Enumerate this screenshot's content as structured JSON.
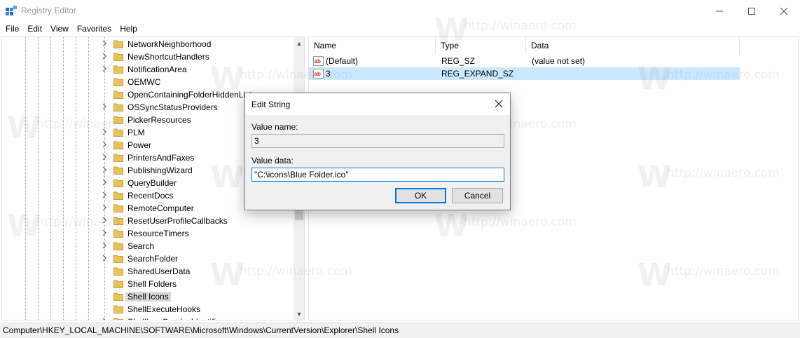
{
  "window": {
    "title": "Registry Editor",
    "minimize_glyph": "—",
    "maximize_glyph": "☐",
    "close_glyph": "✕"
  },
  "menu": [
    "File",
    "Edit",
    "View",
    "Favorites",
    "Help"
  ],
  "tree": {
    "items": [
      {
        "label": "NetworkNeighborhood",
        "expandable": true
      },
      {
        "label": "NewShortcutHandlers",
        "expandable": true
      },
      {
        "label": "NotificationArea",
        "expandable": true
      },
      {
        "label": "OEMWC",
        "expandable": false
      },
      {
        "label": "OpenContainingFolderHiddenList",
        "expandable": false
      },
      {
        "label": "OSSyncStatusProviders",
        "expandable": true
      },
      {
        "label": "PickerResources",
        "expandable": false
      },
      {
        "label": "PLM",
        "expandable": true
      },
      {
        "label": "Power",
        "expandable": true
      },
      {
        "label": "PrintersAndFaxes",
        "expandable": true
      },
      {
        "label": "PublishingWizard",
        "expandable": true
      },
      {
        "label": "QueryBuilder",
        "expandable": true
      },
      {
        "label": "RecentDocs",
        "expandable": true
      },
      {
        "label": "RemoteComputer",
        "expandable": true
      },
      {
        "label": "ResetUserProfileCallbacks",
        "expandable": true
      },
      {
        "label": "ResourceTimers",
        "expandable": true
      },
      {
        "label": "Search",
        "expandable": true
      },
      {
        "label": "SearchFolder",
        "expandable": true
      },
      {
        "label": "SharedUserData",
        "expandable": false
      },
      {
        "label": "Shell Folders",
        "expandable": false
      },
      {
        "label": "Shell Icons",
        "expandable": false,
        "selected": true
      },
      {
        "label": "ShellExecuteHooks",
        "expandable": false
      },
      {
        "label": "ShellIconOverlayIdentifiers",
        "expandable": true
      }
    ],
    "scroll_up_glyph": "▲",
    "scroll_down_glyph": "▼"
  },
  "list": {
    "columns": [
      "Name",
      "Type",
      "Data"
    ],
    "rows": [
      {
        "name": "(Default)",
        "type": "REG_SZ",
        "data": "(value not set)",
        "icon": "string-value-icon"
      },
      {
        "name": "3",
        "type": "REG_EXPAND_SZ",
        "data": "",
        "icon": "string-value-icon",
        "selected": true
      }
    ]
  },
  "status": {
    "path": "Computer\\HKEY_LOCAL_MACHINE\\SOFTWARE\\Microsoft\\Windows\\CurrentVersion\\Explorer\\Shell Icons"
  },
  "dialog": {
    "title": "Edit String",
    "value_name_label": "Value name:",
    "value_name": "3",
    "value_data_label": "Value data:",
    "value_data": "\"C:\\icons\\Blue Folder.ico\"",
    "ok_label": "OK",
    "cancel_label": "Cancel"
  },
  "watermark": {
    "text": "http://winaero.com",
    "letter": "W"
  },
  "colors": {
    "selection": "#cce8ff",
    "folder": "#e8c25a",
    "accent": "#0078d7",
    "ab_icon": "#d0312d"
  }
}
